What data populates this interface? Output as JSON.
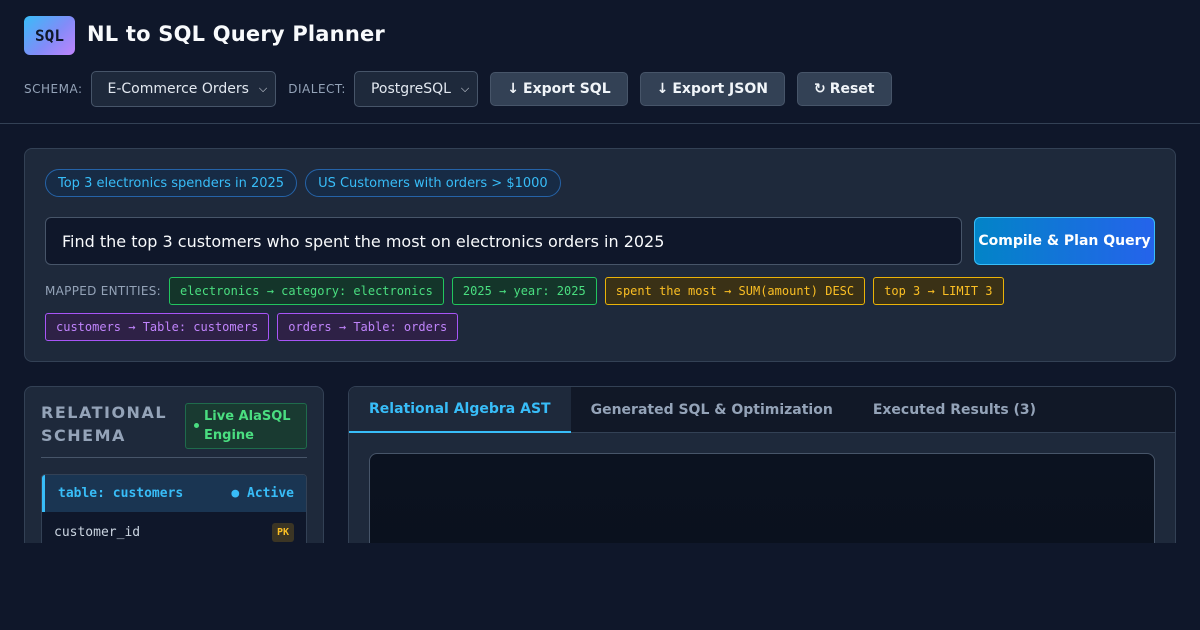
{
  "app": {
    "logo_text": "SQL",
    "title": "NL to SQL Query Planner"
  },
  "toolbar": {
    "schema_label": "SCHEMA:",
    "schema_value": "E-Commerce Orders",
    "dialect_label": "DIALECT:",
    "dialect_value": "PostgreSQL",
    "export_sql": {
      "icon": "↓",
      "label": "Export SQL"
    },
    "export_json": {
      "icon": "↓",
      "label": "Export JSON"
    },
    "reset": {
      "icon": "↻",
      "label": "Reset"
    }
  },
  "query": {
    "examples": [
      "Top 3 electronics spenders in 2025",
      "US Customers with orders > $1000"
    ],
    "input_value": "Find the top 3 customers who spent the most on electronics orders in 2025",
    "compile_label": "Compile & Plan Query",
    "entities_label": "MAPPED ENTITIES:",
    "entities": [
      {
        "text": "electronics → category: electronics",
        "color": "#4ade80"
      },
      {
        "text": "2025 → year: 2025",
        "color": "#4ade80"
      },
      {
        "text": "spent the most → SUM(amount) DESC",
        "color": "#fbbf24"
      },
      {
        "text": "top 3 → LIMIT 3",
        "color": "#fbbf24"
      },
      {
        "text": "customers → Table: customers",
        "color": "#c084fc"
      },
      {
        "text": "orders → Table: orders",
        "color": "#c084fc"
      }
    ]
  },
  "schema_panel": {
    "title": "RELATIONAL SCHEMA",
    "engine_badge": "Live AlaSQL Engine",
    "tables": [
      {
        "name": "table: customers",
        "status": "● Active",
        "columns": [
          {
            "name": "customer_id",
            "badge": "PK"
          }
        ]
      }
    ]
  },
  "main_panel": {
    "tabs": [
      "Relational Algebra AST",
      "Generated SQL & Optimization",
      "Executed Results (3)"
    ],
    "active_tab": 0
  },
  "colors": {
    "background": "#0f172a",
    "panel": "#1e293b",
    "accent": "#38bdf8",
    "success": "#4ade80",
    "warning": "#fbbf24",
    "purple": "#c084fc"
  }
}
